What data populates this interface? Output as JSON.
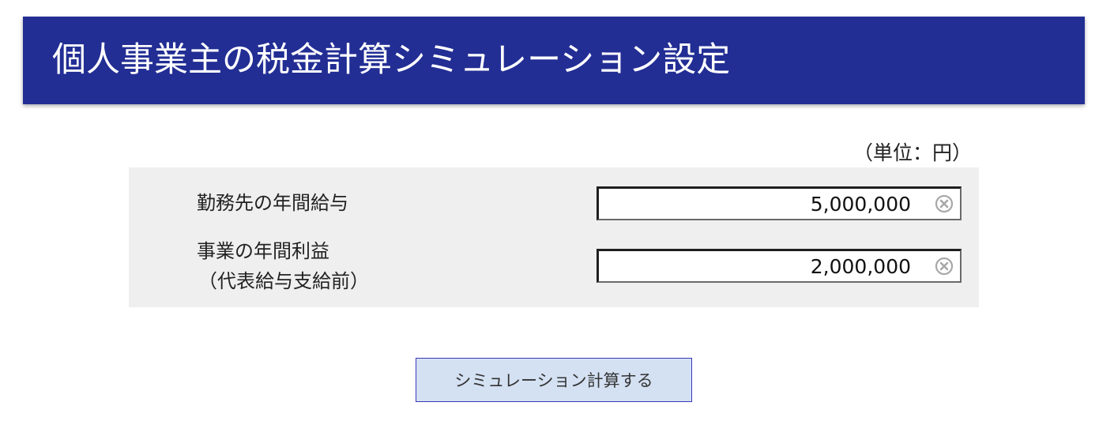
{
  "header": {
    "title": "個人事業主の税金計算シミュレーション設定"
  },
  "form": {
    "unit_label": "（単位：円）",
    "fields": [
      {
        "label": "勤務先の年間給与",
        "sublabel": "",
        "value": "5,000,000",
        "clear_icon": "clear-circle-x-icon"
      },
      {
        "label": "事業の年間利益",
        "sublabel": "（代表給与支給前）",
        "value": "2,000,000",
        "clear_icon": "clear-circle-x-icon"
      }
    ]
  },
  "actions": {
    "submit_label": "シミュレーション計算する"
  },
  "colors": {
    "header_bg": "#222e94",
    "panel_bg": "#efefef",
    "button_bg": "#d4e1f3",
    "button_border": "#3a3ab8"
  }
}
